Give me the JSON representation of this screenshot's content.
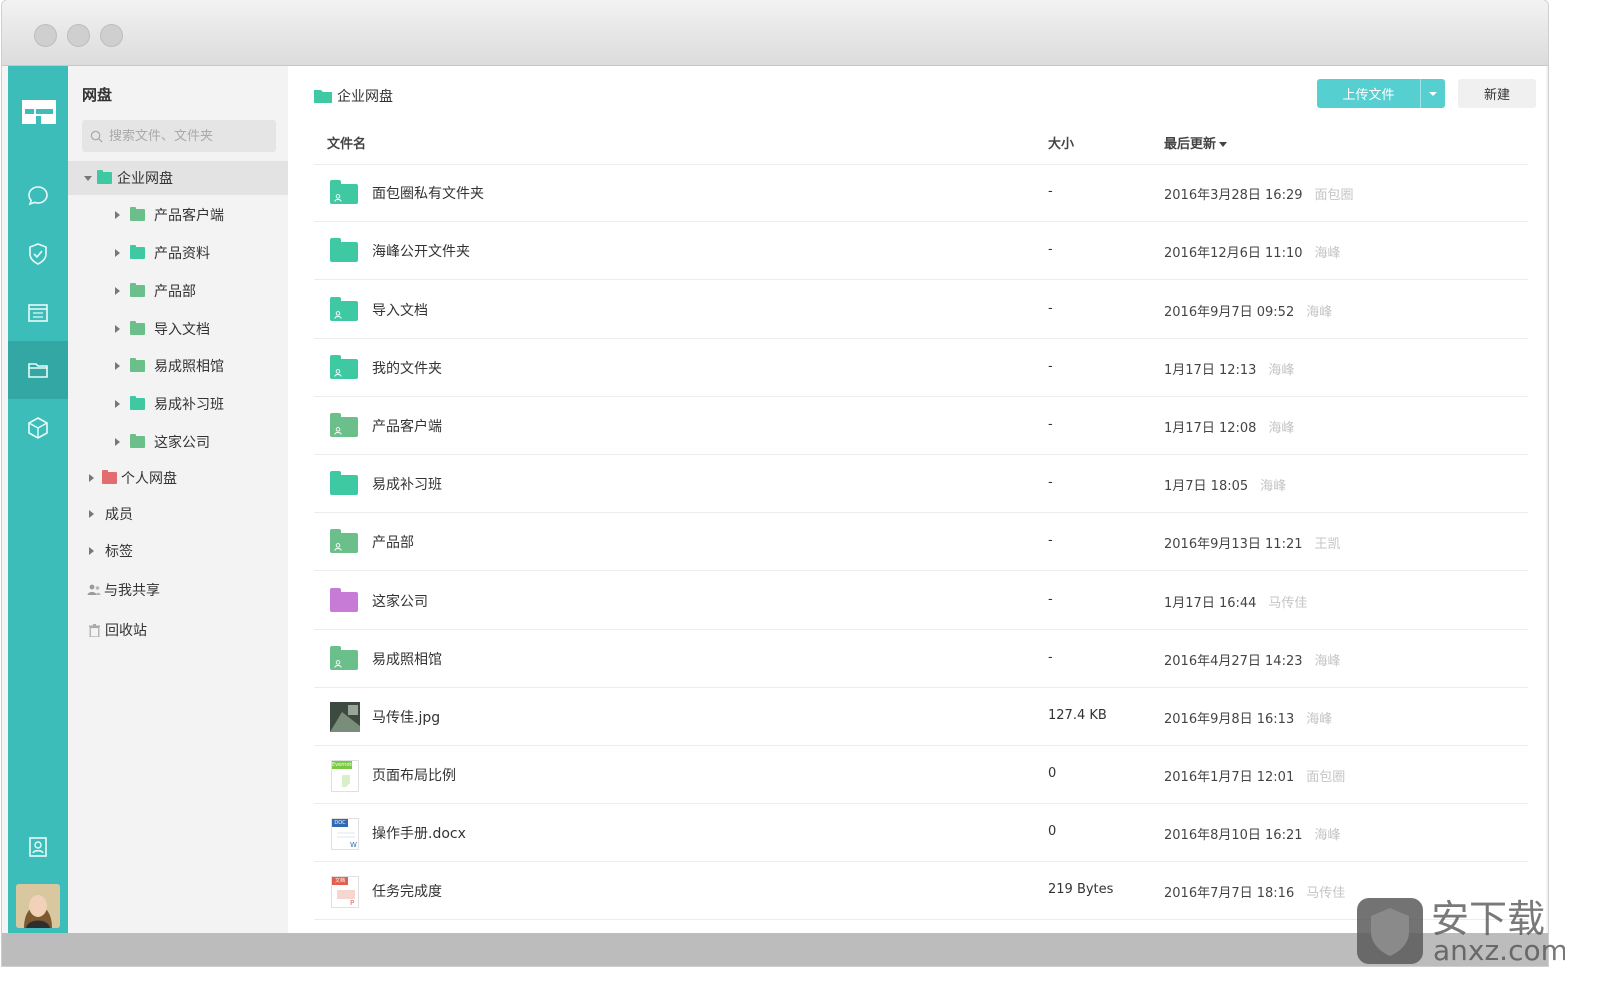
{
  "sidebar": {
    "title": "网盘",
    "search_placeholder": "搜索文件、文件夹",
    "tree": [
      {
        "label": "企业网盘",
        "level": 0,
        "expanded": true,
        "selected": true,
        "color": "#3ec9a3"
      },
      {
        "label": "产品客户端",
        "level": 1,
        "color": "#6abf8a"
      },
      {
        "label": "产品资料",
        "level": 1,
        "color": "#3ec9a3"
      },
      {
        "label": "产品部",
        "level": 1,
        "color": "#6abf8a"
      },
      {
        "label": "导入文档",
        "level": 1,
        "color": "#6abf8a"
      },
      {
        "label": "易成照相馆",
        "level": 1,
        "color": "#6abf8a"
      },
      {
        "label": "易成补习班",
        "level": 1,
        "color": "#3ec9a3"
      },
      {
        "label": "这家公司",
        "level": 1,
        "color": "#6abf8a"
      },
      {
        "label": "个人网盘",
        "level": 0,
        "color": "#e36d6d"
      },
      {
        "label": "成员",
        "level": 0
      },
      {
        "label": "标签",
        "level": 0
      },
      {
        "label": "与我共享",
        "level": 0,
        "icon": "people-icon"
      },
      {
        "label": "回收站",
        "level": 0,
        "icon": "trash-icon"
      }
    ]
  },
  "main": {
    "breadcrumb": "企业网盘",
    "upload_label": "上传文件",
    "new_label": "新建",
    "columns": {
      "name": "文件名",
      "size": "大小",
      "updated": "最后更新"
    },
    "files": [
      {
        "name": "面包圈私有文件夹",
        "size": "-",
        "date": "2016年3月28日 16:29",
        "user": "面包圈",
        "icon": "folder-shared-icon",
        "color": "#3ec9a3"
      },
      {
        "name": "海峰公开文件夹",
        "size": "-",
        "date": "2016年12月6日 11:10",
        "user": "海峰",
        "icon": "folder-icon",
        "color": "#3ec9a3"
      },
      {
        "name": "导入文档",
        "size": "-",
        "date": "2016年9月7日 09:52",
        "user": "海峰",
        "icon": "folder-shared-icon",
        "color": "#3ec9a3"
      },
      {
        "name": "我的文件夹",
        "size": "-",
        "date": "1月17日 12:13",
        "user": "海峰",
        "icon": "folder-shared-icon",
        "color": "#3ec9a3"
      },
      {
        "name": "产品客户端",
        "size": "-",
        "date": "1月17日 12:08",
        "user": "海峰",
        "icon": "folder-shared-icon",
        "color": "#6abf8a"
      },
      {
        "name": "易成补习班",
        "size": "-",
        "date": "1月7日 18:05",
        "user": "海峰",
        "icon": "folder-icon",
        "color": "#3ec9a3"
      },
      {
        "name": "产品部",
        "size": "-",
        "date": "2016年9月13日 11:21",
        "user": "王凯",
        "icon": "folder-shared-icon",
        "color": "#6abf8a"
      },
      {
        "name": "这家公司",
        "size": "-",
        "date": "1月17日 16:44",
        "user": "马传佳",
        "icon": "folder-icon",
        "color": "#c77ad6"
      },
      {
        "name": "易成照相馆",
        "size": "-",
        "date": "2016年4月27日 14:23",
        "user": "海峰",
        "icon": "folder-shared-icon",
        "color": "#6abf8a"
      },
      {
        "name": "马传佳.jpg",
        "size": "127.4 KB",
        "date": "2016年9月8日 16:13",
        "user": "海峰",
        "icon": "image-thumbnail-icon"
      },
      {
        "name": "页面布局比例",
        "size": "0",
        "date": "2016年1月7日 12:01",
        "user": "面包圈",
        "icon": "evernote-note-icon"
      },
      {
        "name": "操作手册.docx",
        "size": "0",
        "date": "2016年8月10日 16:21",
        "user": "海峰",
        "icon": "word-doc-icon"
      },
      {
        "name": "任务完成度",
        "size": "219 Bytes",
        "date": "2016年7月7日 18:16",
        "user": "马传佳",
        "icon": "ppt-doc-icon"
      }
    ]
  },
  "rail": {
    "items": [
      "logo-icon",
      "chat-icon",
      "task-icon",
      "calendar-icon",
      "folder-icon",
      "cube-icon",
      "contacts-icon"
    ],
    "active": "folder-icon"
  },
  "colors": {
    "accent": "#3dbdb9",
    "upload": "#56cfd0"
  }
}
